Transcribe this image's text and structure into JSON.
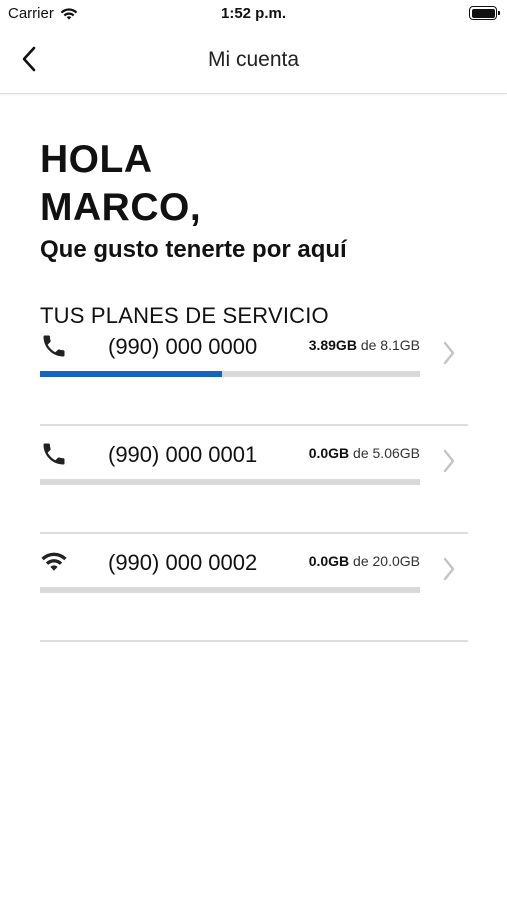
{
  "status_bar": {
    "carrier": "Carrier",
    "time": "1:52 p.m."
  },
  "nav": {
    "title": "Mi cuenta"
  },
  "greeting": {
    "line1": "HOLA",
    "line2": "MARCO,",
    "subtitle": "Que gusto tenerte por aquí"
  },
  "section_title": "TUS PLANES DE SERVICIO",
  "plans": [
    {
      "icon": "phone-icon",
      "number": "(990) 000 0000",
      "used": "3.89GB",
      "separator": "de",
      "total": "8.1GB",
      "usage_fraction": 0.48
    },
    {
      "icon": "phone-icon",
      "number": "(990) 000 0001",
      "used": "0.0GB",
      "separator": "de",
      "total": "5.06GB",
      "usage_fraction": 0.0
    },
    {
      "icon": "wifi-icon",
      "number": "(990) 000 0002",
      "used": "0.0GB",
      "separator": "de",
      "total": "20.0GB",
      "usage_fraction": 0.0
    }
  ],
  "colors": {
    "accent": "#1565c0",
    "bar_track": "#d9d9d9",
    "divider": "#dddddd"
  }
}
